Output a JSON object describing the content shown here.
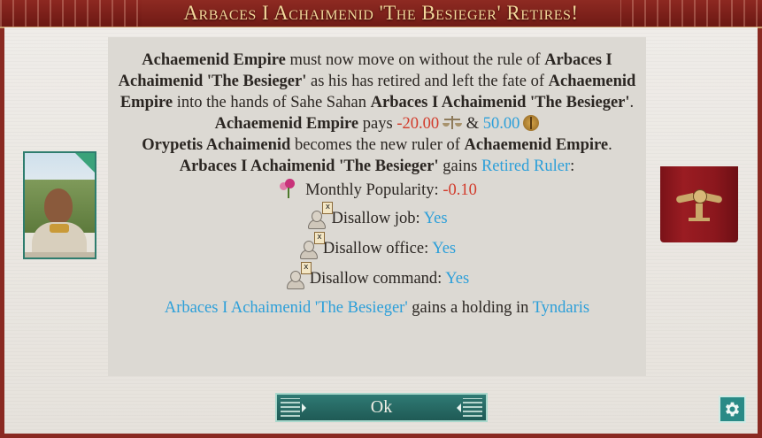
{
  "dialog": {
    "title": "Arbaces I Achaimenid 'The Besieger' Retires!"
  },
  "message": {
    "p1": {
      "empire_a": "Achaemenid Empire",
      "text_a": " must now move on without the rule of ",
      "ruler_a": "Arbaces I Achaimenid 'The Besieger'",
      "text_b": " as his has retired and left the fate of ",
      "empire_b": "Achaemenid Empire",
      "text_c": " into the hands of Sahe Sahan ",
      "ruler_b": "Arbaces I Achaimenid 'The Besieger'",
      "text_d": "."
    },
    "p2": {
      "empire": "Achaemenid Empire",
      "pays": " pays ",
      "amount_1": "-20.00",
      "amp": " & ",
      "amount_2": "50.00"
    },
    "p3": {
      "new_ruler": "Orypetis Achaimenid",
      "text": " becomes the new ruler of ",
      "empire": "Achaemenid Empire",
      "end": "."
    },
    "p4": {
      "ruler": "Arbaces I Achaimenid 'The Besieger'",
      "text": " gains ",
      "trait": "Retired Ruler",
      "end": ":"
    },
    "effects": [
      {
        "label": "Monthly Popularity: ",
        "value": "-0.10",
        "icon": "popularity-flower-icon"
      },
      {
        "label": "Disallow job: ",
        "value": "Yes",
        "icon": "disallow-bust-icon"
      },
      {
        "label": "Disallow office: ",
        "value": "Yes",
        "icon": "disallow-bust-icon"
      },
      {
        "label": "Disallow command: ",
        "value": "Yes",
        "icon": "disallow-bust-icon"
      }
    ],
    "holding": {
      "ruler": "Arbaces I Achaimenid 'The Besieger'",
      "text": " gains a holding in ",
      "place": "Tyndaris"
    }
  },
  "buttons": {
    "ok_label": "Ok"
  },
  "colors": {
    "negative": "#d23b2b",
    "link_blue": "#2c9fd9",
    "title_gold": "#f3d79a",
    "accent_teal": "#2f7a74"
  }
}
